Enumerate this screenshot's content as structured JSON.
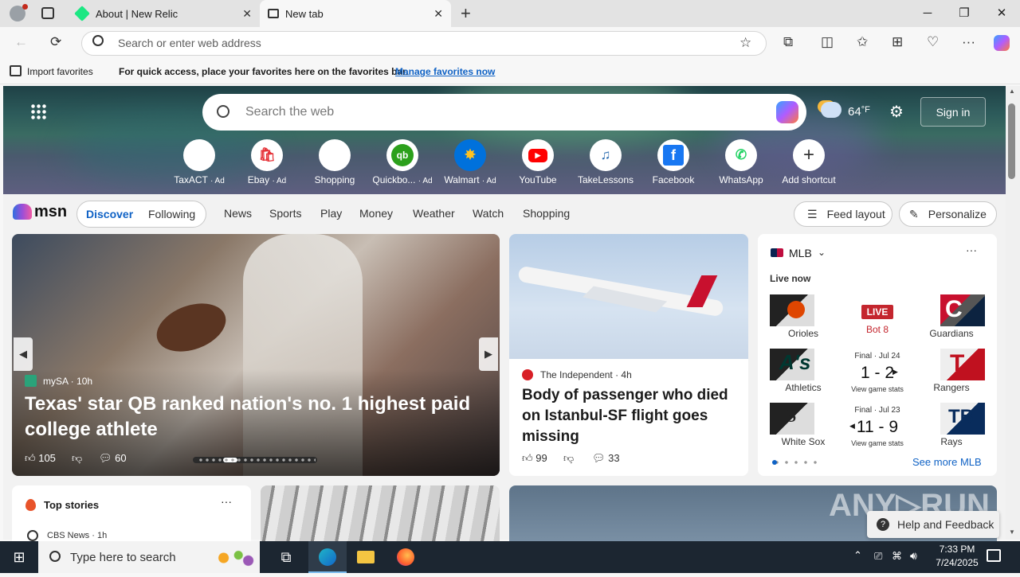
{
  "browser": {
    "tabs": [
      {
        "title": "About | New Relic"
      },
      {
        "title": "New tab"
      }
    ],
    "address_placeholder": "Search or enter web address",
    "favbar": {
      "import_label": "Import favorites",
      "message": "For quick access, place your favorites here on the favorites bar.",
      "manage_link": "Manage favorites now"
    }
  },
  "msn": {
    "search_placeholder": "Search the web",
    "weather": {
      "temp": "64",
      "unit": "°F"
    },
    "sign_in": "Sign in",
    "shortcuts": [
      {
        "label": "TaxACT",
        "ad": "· Ad",
        "color": "#1b1b1b"
      },
      {
        "label": "Ebay",
        "ad": "· Ad",
        "color": "#e53238"
      },
      {
        "label": "Shopping",
        "ad": "",
        "color": "#1b1b1b"
      },
      {
        "label": "Quickbo...",
        "ad": "· Ad",
        "color": "#2ca01c"
      },
      {
        "label": "Walmart",
        "ad": "· Ad",
        "color": "#0071dc"
      },
      {
        "label": "YouTube",
        "ad": "",
        "color": "#ff0000"
      },
      {
        "label": "TakeLessons",
        "ad": "",
        "color": "#2b6cb0"
      },
      {
        "label": "Facebook",
        "ad": "",
        "color": "#1877f2"
      },
      {
        "label": "WhatsApp",
        "ad": "",
        "color": "#25d366"
      },
      {
        "label": "Add shortcut",
        "ad": "",
        "color": "#333"
      }
    ],
    "logo": "msn",
    "nav": {
      "discover": "Discover",
      "following": "Following",
      "links": [
        "News",
        "Sports",
        "Play",
        "Money",
        "Weather",
        "Watch",
        "Shopping"
      ],
      "feed_layout": "Feed layout",
      "personalize": "Personalize"
    },
    "hero_story": {
      "source": "mySA",
      "age": "10h",
      "headline": "Texas' star QB ranked nation's no. 1 highest paid college athlete",
      "likes": "105",
      "comments": "60"
    },
    "plane_story": {
      "source": "The Independent",
      "age": "4h",
      "headline": "Body of passenger who died on Istanbul-SF flight goes missing",
      "likes": "99",
      "comments": "33"
    },
    "mlb": {
      "title": "MLB",
      "live_now": "Live now",
      "games": [
        {
          "home": "Orioles",
          "away": "Guardians",
          "status": "LIVE",
          "detail": "Bot 8",
          "score": "",
          "sub": ""
        },
        {
          "home": "Athletics",
          "away": "Rangers",
          "status": "Final · Jul 24",
          "detail": "",
          "score": "1 - 2",
          "sub": "View game stats"
        },
        {
          "home": "White Sox",
          "away": "Rays",
          "status": "Final · Jul 23",
          "detail": "",
          "score": "11 - 9",
          "sub": "View game stats"
        }
      ],
      "see_more": "See more MLB"
    },
    "top_stories": {
      "title": "Top stories",
      "first_source": "CBS News · 1h"
    },
    "help": "Help and Feedback"
  },
  "taskbar": {
    "search_placeholder": "Type here to search",
    "time": "7:33 PM",
    "date": "7/24/2025"
  }
}
